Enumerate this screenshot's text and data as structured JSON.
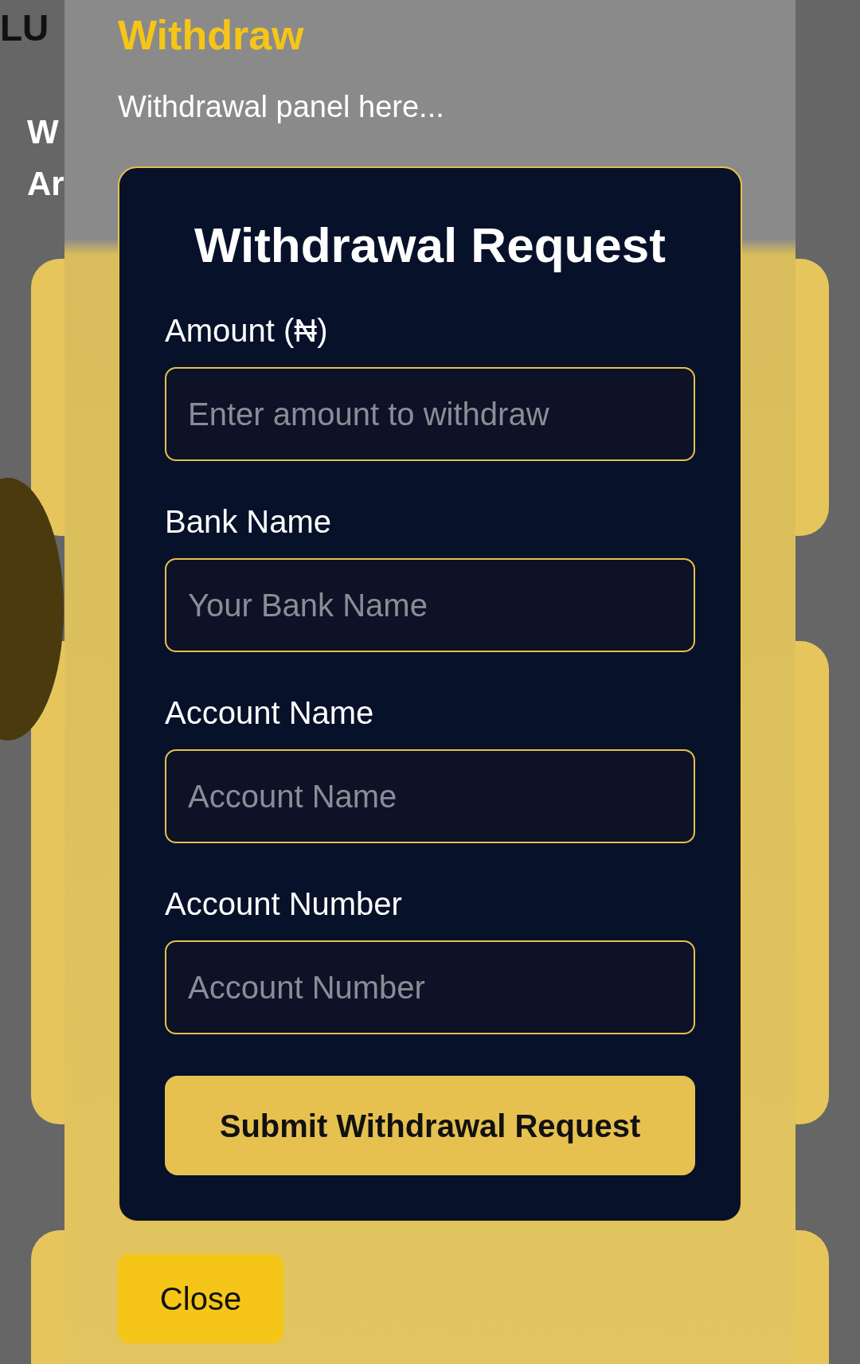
{
  "background": {
    "texts": [
      "LU",
      "W",
      "Ar"
    ]
  },
  "modal": {
    "title": "Withdraw",
    "subtitle": "Withdrawal panel here...",
    "form": {
      "title": "Withdrawal Request",
      "fields": [
        {
          "label": "Amount (₦)",
          "placeholder": "Enter amount to withdraw"
        },
        {
          "label": "Bank Name",
          "placeholder": "Your Bank Name"
        },
        {
          "label": "Account Name",
          "placeholder": "Account Name"
        },
        {
          "label": "Account Number",
          "placeholder": "Account Number"
        }
      ],
      "submit": "Submit Withdrawal Request"
    },
    "close": "Close"
  }
}
